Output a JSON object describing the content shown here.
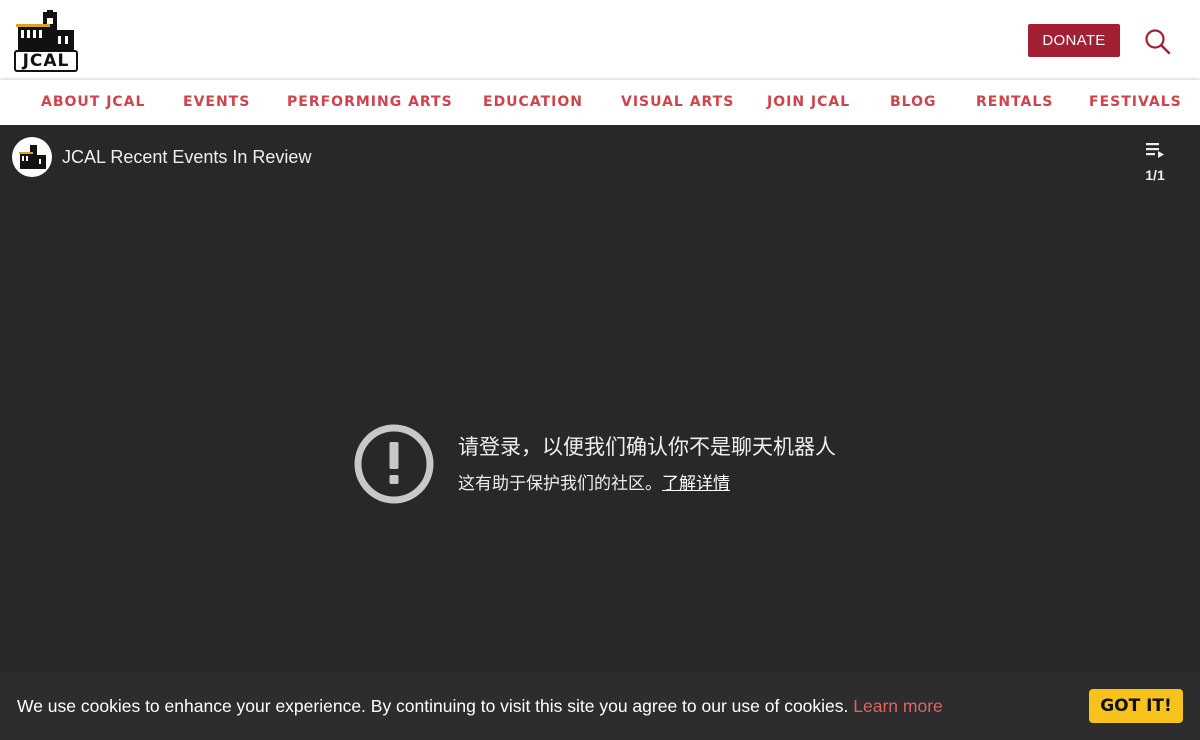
{
  "header": {
    "logo_text": "JCAL",
    "donate_label": "DONATE",
    "search_icon": "search-icon"
  },
  "nav": {
    "items": [
      {
        "label": "ABOUT JCAL"
      },
      {
        "label": "EVENTS"
      },
      {
        "label": "PERFORMING ARTS"
      },
      {
        "label": "EDUCATION"
      },
      {
        "label": "VISUAL ARTS"
      },
      {
        "label": "JOIN JCAL"
      },
      {
        "label": "BLOG"
      },
      {
        "label": "RENTALS"
      },
      {
        "label": "FESTIVALS"
      }
    ]
  },
  "video": {
    "title": "JCAL Recent Events In Review",
    "playlist_count": "1/1",
    "signin_message": "请登录，以便我们确认你不是聊天机器人",
    "help_message": "这有助于保护我们的社区。",
    "learn_details": "了解详情"
  },
  "cookie": {
    "text": "We use cookies to enhance your experience. By continuing to visit this site you agree to our use of cookies.",
    "learn_more": "Learn more",
    "button_label": "GOT IT!"
  },
  "colors": {
    "brand_red": "#a31f33",
    "nav_text": "#d2424a",
    "video_bg": "#282828",
    "cookie_bg": "#2d2d2d",
    "got_it_yellow": "#f7c21b"
  }
}
